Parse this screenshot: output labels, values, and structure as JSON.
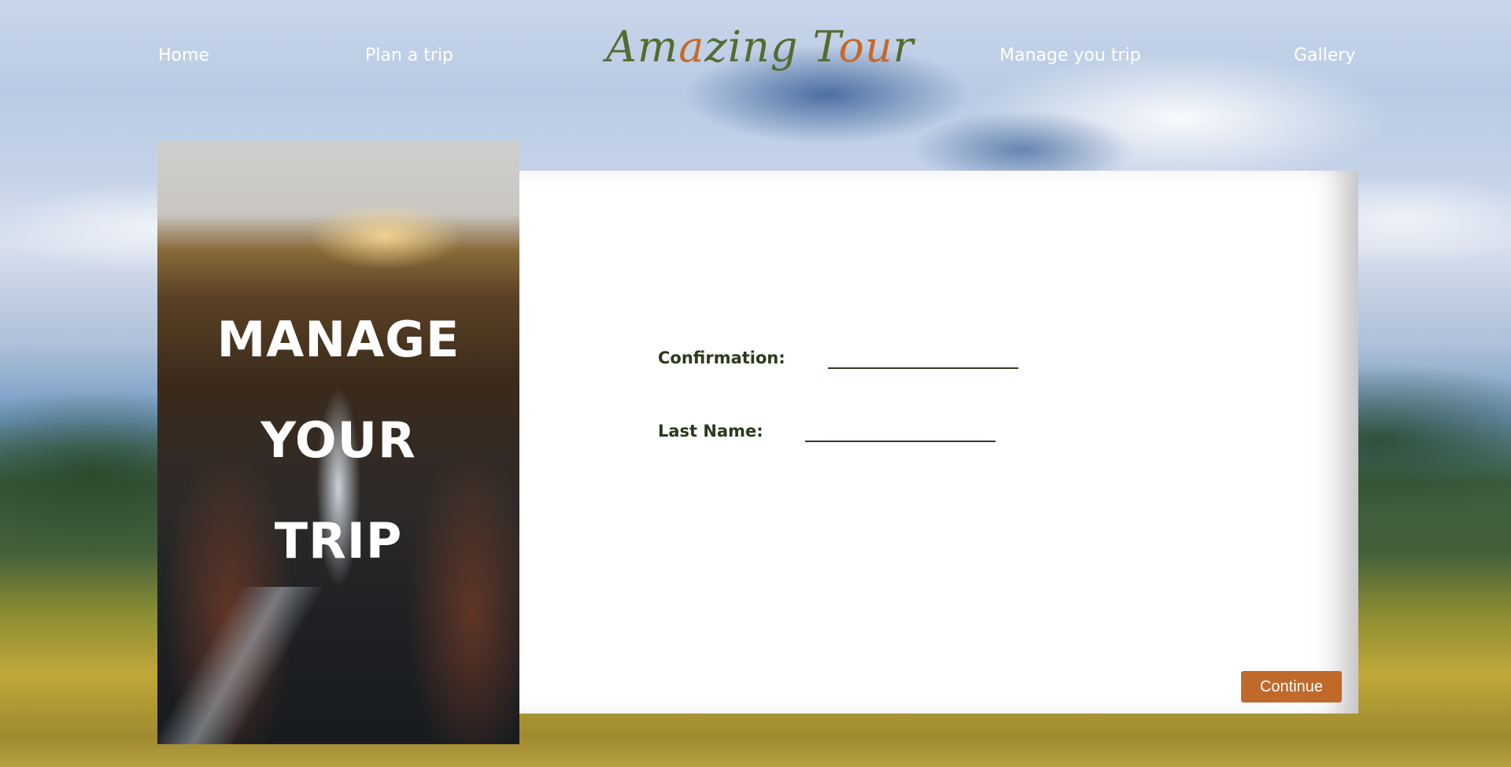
{
  "nav": {
    "home": "Home",
    "plan_trip": "Plan a trip",
    "manage_trip": "Manage you trip",
    "gallery": "Gallery"
  },
  "logo": {
    "part1": "Am",
    "part2": "a",
    "part3": "zing T",
    "part4": "ou",
    "part5": "r"
  },
  "side": {
    "line1": "MANAGE",
    "line2": "YOUR",
    "line3": "TRIP"
  },
  "form": {
    "confirmation_label": "Confirmation:",
    "confirmation_value": "",
    "last_name_label": "Last Name:",
    "last_name_value": "",
    "continue_label": "Continue"
  },
  "colors": {
    "accent": "#bf6a2b",
    "logo_green": "#556b2f",
    "label_text": "#2b3a1c"
  }
}
